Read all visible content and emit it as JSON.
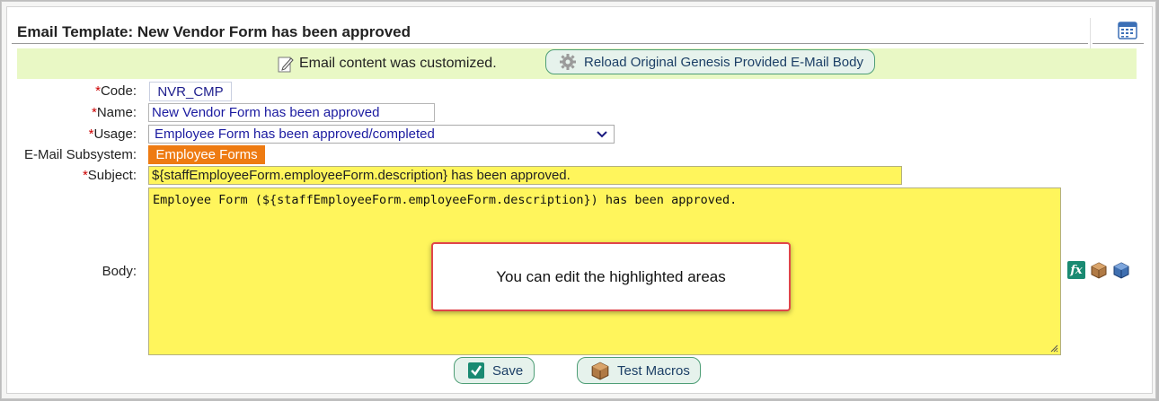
{
  "header": {
    "title": "Email Template: New Vendor Form has been approved",
    "calendar_icon": "calendar-icon"
  },
  "banner": {
    "message": "Email content was customized.",
    "message_icon": "edit-note-icon",
    "reload_button_label": "Reload Original Genesis Provided E-Mail Body",
    "reload_icon": "gear-icon",
    "background": "#e9f8c5"
  },
  "form": {
    "required_marker": "*",
    "code_label": "Code:",
    "code_value": "NVR_CMP",
    "name_label": "Name:",
    "name_value": "New Vendor Form has been approved",
    "usage_label": "Usage:",
    "usage_value": "Employee Form has been approved/completed",
    "subsystem_label": "E-Mail Subsystem:",
    "subsystem_value": "Employee Forms",
    "subject_label": "Subject:",
    "subject_value": "${staffEmployeeForm.employeeForm.description} has been approved.",
    "body_label": "Body:",
    "body_value": "Employee Form (${staffEmployeeForm.employeeForm.description}) has been approved."
  },
  "tooltip": {
    "text": "You can edit the highlighted areas"
  },
  "side_icons": {
    "fx_label": "fx",
    "icons": [
      "function-icon",
      "box-icon",
      "cube-icon"
    ]
  },
  "actions": {
    "save_label": "Save",
    "test_macros_label": "Test Macros"
  },
  "colors": {
    "highlight": "#fff55c",
    "subsystem_tag": "#ee7b12",
    "required": "#cc0000",
    "button_border": "#4e9e76"
  }
}
